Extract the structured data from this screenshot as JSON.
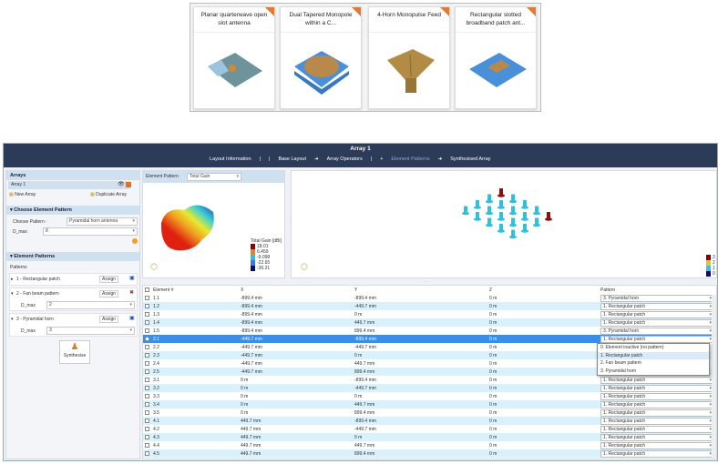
{
  "gallery": [
    {
      "title": "Planar quarterwave open slot antenna"
    },
    {
      "title": "Dual Tapered Monopole within a C..."
    },
    {
      "title": "4-Horn Monopulse Feed"
    },
    {
      "title": "Rectangular slotted broadband patch ant..."
    }
  ],
  "header": {
    "title": "Array 1",
    "crumbs": [
      "Layout Information",
      "|",
      "|",
      "Base Layout",
      "➜",
      "Array Operators",
      "|",
      "+",
      "Element Patterns",
      "➜",
      "Synthesised Array"
    ],
    "active_crumb": "Element Patterns"
  },
  "arrays": {
    "title": "Arrays",
    "item": "Array 1",
    "new_label": "New Array",
    "duplicate_label": "Duplicate Array"
  },
  "choose": {
    "title": "Choose Element Pattern",
    "pattern_label": "Choose Pattern :",
    "pattern_value": "Pyramidal horn antenna",
    "dmax_label": "D_max",
    "dmax_value": "8"
  },
  "patterns": {
    "title": "Element Patterns",
    "label": "Patterns",
    "assign_label": "Assign",
    "items": [
      {
        "name": "1 - Rectangular patch",
        "expanded": false
      },
      {
        "name": "2 - Fan beam pattern",
        "expanded": true,
        "dmax_label": "D_max",
        "dmax_value": "2"
      },
      {
        "name": "3 - Pyramidal horn",
        "expanded": true,
        "dmax_label": "D_max",
        "dmax_value": "3"
      }
    ]
  },
  "synthesise_label": "Synthesise",
  "element_view": {
    "label": "Element Pattern",
    "quantity": "Total Gain",
    "legend_title": "Total Gain [dBi]",
    "legend": [
      {
        "v": "18.01",
        "c": "#8b0000"
      },
      {
        "v": "6.459",
        "c": "#f08020"
      },
      {
        "v": "-9.098",
        "c": "#30c0d0"
      },
      {
        "v": "-22.65",
        "c": "#3080e0"
      },
      {
        "v": "-36.21",
        "c": "#0a0a80"
      }
    ]
  },
  "array_view": {
    "legend": [
      {
        "v": "3",
        "c": "#8b0000"
      },
      {
        "v": "2",
        "c": "#f0c020"
      },
      {
        "v": "1",
        "c": "#30c8e0"
      },
      {
        "v": "0",
        "c": "#0a0a80"
      }
    ]
  },
  "table": {
    "headers": [
      "Element #",
      "X",
      "Y",
      "Z",
      "Pattern"
    ],
    "selected": "2.1",
    "rows": [
      [
        "1.1",
        "-899.4 mm",
        "-899.4 mm",
        "0 m",
        "3. Pyramidal horn"
      ],
      [
        "1.2",
        "-899.4 mm",
        "-449.7 mm",
        "0 m",
        "1. Rectangular patch"
      ],
      [
        "1.3",
        "-899.4 mm",
        "0 m",
        "0 m",
        "1. Rectangular patch"
      ],
      [
        "1.4",
        "-899.4 mm",
        "449.7 mm",
        "0 m",
        "1. Rectangular patch"
      ],
      [
        "1.5",
        "-899.4 mm",
        "899.4 mm",
        "0 m",
        "3. Pyramidal horn"
      ],
      [
        "2.1",
        "-449.7 mm",
        "-899.4 mm",
        "0 m",
        "1. Rectangular patch"
      ],
      [
        "2.2",
        "-449.7 mm",
        "-449.7 mm",
        "0 m",
        ""
      ],
      [
        "2.3",
        "-449.7 mm",
        "0 m",
        "0 m",
        ""
      ],
      [
        "2.4",
        "-449.7 mm",
        "449.7 mm",
        "0 m",
        ""
      ],
      [
        "2.5",
        "-449.7 mm",
        "899.4 mm",
        "0 m",
        ""
      ],
      [
        "3.1",
        "0 m",
        "-899.4 mm",
        "0 m",
        "1. Rectangular patch"
      ],
      [
        "3.2",
        "0 m",
        "-449.7 mm",
        "0 m",
        "1. Rectangular patch"
      ],
      [
        "3.3",
        "0 m",
        "0 m",
        "0 m",
        "1. Rectangular patch"
      ],
      [
        "3.4",
        "0 m",
        "449.7 mm",
        "0 m",
        "1. Rectangular patch"
      ],
      [
        "3.5",
        "0 m",
        "899.4 mm",
        "0 m",
        "1. Rectangular patch"
      ],
      [
        "4.1",
        "449.7 mm",
        "-899.4 mm",
        "0 m",
        "1. Rectangular patch"
      ],
      [
        "4.2",
        "449.7 mm",
        "-449.7 mm",
        "0 m",
        "1. Rectangular patch"
      ],
      [
        "4.3",
        "449.7 mm",
        "0 m",
        "0 m",
        "1. Rectangular patch"
      ],
      [
        "4.4",
        "449.7 mm",
        "449.7 mm",
        "0 m",
        "1. Rectangular patch"
      ],
      [
        "4.5",
        "449.7 mm",
        "899.4 mm",
        "0 m",
        "1. Rectangular patch"
      ]
    ],
    "dropdown_options": [
      "0. Element inactive (no pattern)",
      "1. Rectangular patch",
      "2. Fan beam pattern",
      "3. Pyramidal horn"
    ],
    "dropdown_highlight": "1. Rectangular patch"
  }
}
